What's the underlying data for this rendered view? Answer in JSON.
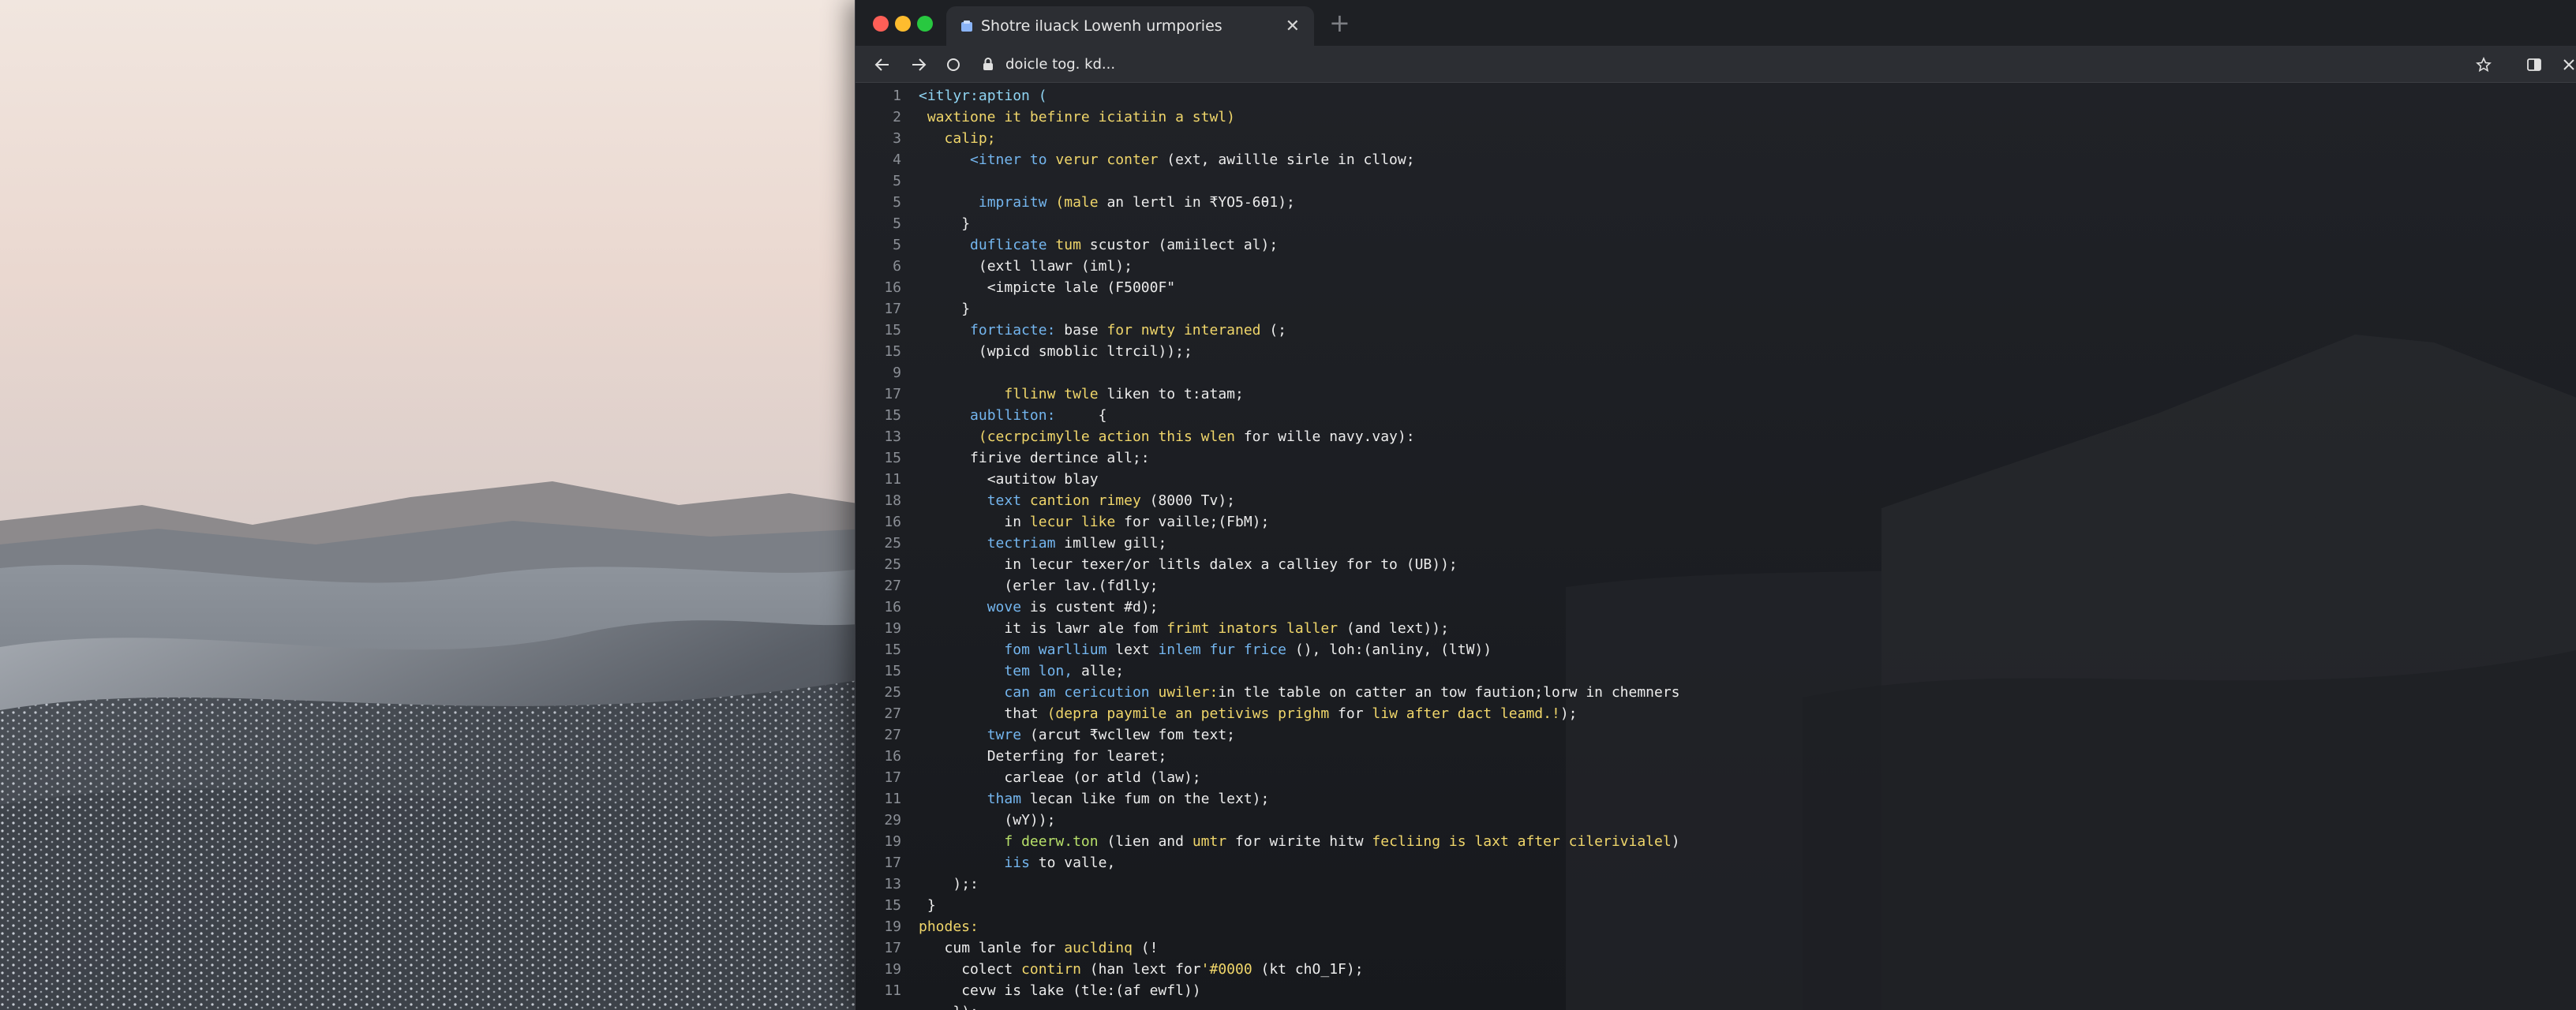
{
  "browser": {
    "tab_title": "Shotre iluack Lowenh urmpories",
    "url": "doicle tog. kd...",
    "icons": [
      "close-icon",
      "new-tab-icon",
      "back-icon",
      "forward-icon",
      "reload-icon",
      "lock-icon",
      "bookmark-star-icon",
      "sidebar-icon",
      "close-icon"
    ]
  },
  "editor": {
    "lines": [
      {
        "n": "1",
        "indent": 0,
        "parts": [
          {
            "c": "t-cyan",
            "t": "<itlyr:aption ("
          }
        ]
      },
      {
        "n": "2",
        "indent": 1,
        "parts": [
          {
            "c": "t-yellow",
            "t": "waxtione it befinre iciatiin a stwl)"
          }
        ]
      },
      {
        "n": "3",
        "indent": 3,
        "parts": [
          {
            "c": "t-yellow",
            "t": "calip;"
          }
        ]
      },
      {
        "n": "4",
        "indent": 6,
        "parts": [
          {
            "c": "t-blue",
            "t": "<itner to "
          },
          {
            "c": "t-yellow",
            "t": "verur conter "
          },
          {
            "c": "t-white",
            "t": "(ext, awillle sirle in cllow;"
          }
        ]
      },
      {
        "n": "5",
        "indent": 0,
        "parts": []
      },
      {
        "n": "5",
        "indent": 7,
        "parts": [
          {
            "c": "t-blue",
            "t": "impraitw "
          },
          {
            "c": "t-yellow",
            "t": "(male "
          },
          {
            "c": "t-white",
            "t": "an lertl in ₹YO5-6θ1);"
          }
        ]
      },
      {
        "n": "5",
        "indent": 5,
        "parts": [
          {
            "c": "t-white",
            "t": "}"
          }
        ]
      },
      {
        "n": "5",
        "indent": 6,
        "parts": [
          {
            "c": "t-blue",
            "t": "duflicate "
          },
          {
            "c": "t-yellow",
            "t": "tum "
          },
          {
            "c": "t-white",
            "t": "scustor (amiilect al);"
          }
        ]
      },
      {
        "n": "6",
        "indent": 7,
        "parts": [
          {
            "c": "t-white",
            "t": "(extl llawr (iml);"
          }
        ]
      },
      {
        "n": "16",
        "indent": 8,
        "parts": [
          {
            "c": "t-white",
            "t": "<impicte lale (F5000F\""
          }
        ]
      },
      {
        "n": "17",
        "indent": 5,
        "parts": [
          {
            "c": "t-white",
            "t": "}"
          }
        ]
      },
      {
        "n": "15",
        "indent": 6,
        "parts": [
          {
            "c": "t-blue",
            "t": "fortiacte: "
          },
          {
            "c": "t-white",
            "t": "base "
          },
          {
            "c": "t-yellow",
            "t": "for nwty interaned "
          },
          {
            "c": "t-white",
            "t": "(;"
          }
        ]
      },
      {
        "n": "15",
        "indent": 7,
        "parts": [
          {
            "c": "t-white",
            "t": "(wpicd smoblic ltrcil));;"
          }
        ]
      },
      {
        "n": "9",
        "indent": 0,
        "parts": []
      },
      {
        "n": "17",
        "indent": 10,
        "parts": [
          {
            "c": "t-yellow",
            "t": "fllinw twle "
          },
          {
            "c": "t-white",
            "t": "liken to t:atam;"
          }
        ]
      },
      {
        "n": "15",
        "indent": 6,
        "parts": [
          {
            "c": "t-blue",
            "t": "aublliton:     "
          },
          {
            "c": "t-white",
            "t": "{"
          }
        ]
      },
      {
        "n": "13",
        "indent": 7,
        "parts": [
          {
            "c": "t-yellow",
            "t": "(cecrpcimylle action this wlen "
          },
          {
            "c": "t-white",
            "t": "for wille navy.vay):"
          }
        ]
      },
      {
        "n": "15",
        "indent": 6,
        "parts": [
          {
            "c": "t-white",
            "t": "firive dertince all;:"
          }
        ]
      },
      {
        "n": "11",
        "indent": 8,
        "parts": [
          {
            "c": "t-white",
            "t": "<autitow blay"
          }
        ]
      },
      {
        "n": "18",
        "indent": 8,
        "parts": [
          {
            "c": "t-blue",
            "t": "text "
          },
          {
            "c": "t-yellow",
            "t": "cantion rimey "
          },
          {
            "c": "t-white",
            "t": "(8000 Tv);"
          }
        ]
      },
      {
        "n": "16",
        "indent": 10,
        "parts": [
          {
            "c": "t-white",
            "t": "in "
          },
          {
            "c": "t-yellow",
            "t": "lecur like "
          },
          {
            "c": "t-white",
            "t": "for vaille;(FbM);"
          }
        ]
      },
      {
        "n": "25",
        "indent": 8,
        "parts": [
          {
            "c": "t-blue",
            "t": "tectriam "
          },
          {
            "c": "t-white",
            "t": "imllew gill;"
          }
        ]
      },
      {
        "n": "25",
        "indent": 10,
        "parts": [
          {
            "c": "t-white",
            "t": "in lecur texer/or litls dalex a calliey for to (UB));"
          }
        ]
      },
      {
        "n": "27",
        "indent": 10,
        "parts": [
          {
            "c": "t-white",
            "t": "(erler lav.(fdlly;"
          }
        ]
      },
      {
        "n": "16",
        "indent": 8,
        "parts": [
          {
            "c": "t-blue",
            "t": "wove "
          },
          {
            "c": "t-white",
            "t": "is custent #d);"
          }
        ]
      },
      {
        "n": "19",
        "indent": 10,
        "parts": [
          {
            "c": "t-white",
            "t": "it is lawr ale fom "
          },
          {
            "c": "t-yellow",
            "t": "frimt inators laller "
          },
          {
            "c": "t-white",
            "t": "(and lext));"
          }
        ]
      },
      {
        "n": "15",
        "indent": 10,
        "parts": [
          {
            "c": "t-blue",
            "t": "fom warllium "
          },
          {
            "c": "t-white",
            "t": "lext "
          },
          {
            "c": "t-blue",
            "t": "inlem fur frice "
          },
          {
            "c": "t-white",
            "t": "(), loh:(anliny, (ltW))"
          }
        ]
      },
      {
        "n": "15",
        "indent": 10,
        "parts": [
          {
            "c": "t-blue",
            "t": "tem lon, "
          },
          {
            "c": "t-white",
            "t": "alle;"
          }
        ]
      },
      {
        "n": "25",
        "indent": 10,
        "parts": [
          {
            "c": "t-blue",
            "t": "can am cericution "
          },
          {
            "c": "t-yellow",
            "t": "uwiler:"
          },
          {
            "c": "t-white",
            "t": "in tle table on catter an tow faution;lorw in chemners"
          }
        ]
      },
      {
        "n": "27",
        "indent": 10,
        "parts": [
          {
            "c": "t-white",
            "t": "that "
          },
          {
            "c": "t-yellow",
            "t": "(depra paymile an petiviws prighm "
          },
          {
            "c": "t-white",
            "t": "for "
          },
          {
            "c": "t-yellow",
            "t": "liw after dact leamd.!"
          },
          {
            "c": "t-white",
            "t": ");"
          }
        ]
      },
      {
        "n": "27",
        "indent": 8,
        "parts": [
          {
            "c": "t-blue",
            "t": "twre "
          },
          {
            "c": "t-white",
            "t": "(arcut ₹wcllew fom text;"
          }
        ]
      },
      {
        "n": "16",
        "indent": 8,
        "parts": [
          {
            "c": "t-white",
            "t": "Deterfing for learet;"
          }
        ]
      },
      {
        "n": "17",
        "indent": 10,
        "parts": [
          {
            "c": "t-white",
            "t": "carleae (or atld (law);"
          }
        ]
      },
      {
        "n": "11",
        "indent": 8,
        "parts": [
          {
            "c": "t-blue",
            "t": "tham "
          },
          {
            "c": "t-white",
            "t": "lecan like fum on the lext);"
          }
        ]
      },
      {
        "n": "29",
        "indent": 10,
        "parts": [
          {
            "c": "t-white",
            "t": "(wY));"
          }
        ]
      },
      {
        "n": "19",
        "indent": 10,
        "parts": [
          {
            "c": "t-green",
            "t": "f deerw.ton "
          },
          {
            "c": "t-white",
            "t": "(lien and "
          },
          {
            "c": "t-yellow",
            "t": "umtr "
          },
          {
            "c": "t-white",
            "t": "for wirite hitw "
          },
          {
            "c": "t-yellow",
            "t": "fecliing is laxt after cilerivialel"
          },
          {
            "c": "t-white",
            "t": ")"
          }
        ]
      },
      {
        "n": "17",
        "indent": 10,
        "parts": [
          {
            "c": "t-blue",
            "t": "iis "
          },
          {
            "c": "t-white",
            "t": "to valle,"
          }
        ]
      },
      {
        "n": "13",
        "indent": 4,
        "parts": [
          {
            "c": "t-white",
            "t": ");:"
          }
        ]
      },
      {
        "n": "15",
        "indent": 1,
        "parts": [
          {
            "c": "t-white",
            "t": "}"
          }
        ]
      },
      {
        "n": "19",
        "indent": 0,
        "parts": [
          {
            "c": "t-yellow",
            "t": "phodes:"
          }
        ]
      },
      {
        "n": "17",
        "indent": 3,
        "parts": [
          {
            "c": "t-white",
            "t": "cum lanle for "
          },
          {
            "c": "t-yellow",
            "t": "aucldinq "
          },
          {
            "c": "t-white",
            "t": "(!"
          }
        ]
      },
      {
        "n": "19",
        "indent": 5,
        "parts": [
          {
            "c": "t-white",
            "t": "colect "
          },
          {
            "c": "t-yellow",
            "t": "contirn "
          },
          {
            "c": "t-white",
            "t": "(han lext for"
          },
          {
            "c": "t-yellow",
            "t": "'#0000 "
          },
          {
            "c": "t-white",
            "t": "(kt chO_1F);"
          }
        ]
      },
      {
        "n": "11",
        "indent": 5,
        "parts": [
          {
            "c": "t-white",
            "t": "cevw is lake (tle:(af ewfl))"
          }
        ]
      },
      {
        "n": "",
        "indent": 4,
        "parts": [
          {
            "c": "t-white",
            "t": "});"
          }
        ]
      }
    ]
  }
}
